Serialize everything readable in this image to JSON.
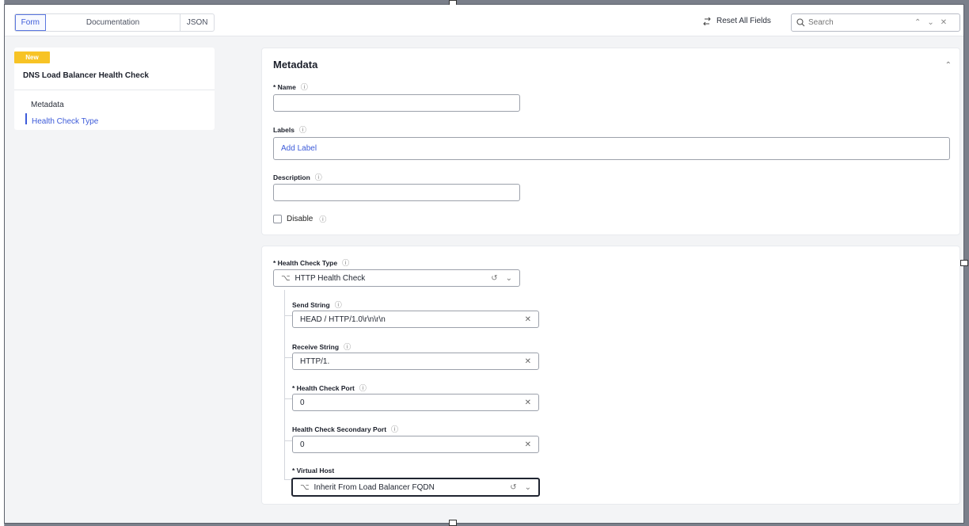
{
  "topbar": {
    "tabs": [
      "Form",
      "Documentation",
      "JSON"
    ],
    "active_tab": "Form",
    "reset_label": "Reset All Fields",
    "search_placeholder": "Search"
  },
  "nav": {
    "badge": "New",
    "title": "DNS Load Balancer Health Check",
    "items": [
      {
        "label": "Metadata"
      },
      {
        "label": "Health Check Type"
      }
    ]
  },
  "metadata": {
    "title": "Metadata",
    "name_label": "* Name",
    "name_value": "",
    "labels_label": "Labels",
    "add_label": "Add Label",
    "description_label": "Description",
    "description_value": "",
    "disable_label": "Disable"
  },
  "health": {
    "type_label": "* Health Check Type",
    "type_value": "HTTP Health Check",
    "send_label": "Send String",
    "send_value": "HEAD / HTTP/1.0\\r\\n\\r\\n",
    "receive_label": "Receive String",
    "receive_value": "HTTP/1.",
    "port_label": "* Health Check Port",
    "port_value": "0",
    "secondary_label": "Health Check Secondary Port",
    "secondary_value": "0",
    "vhost_label": "* Virtual Host",
    "vhost_value": "Inherit From Load Balancer FQDN"
  },
  "colors": {
    "accent": "#3d5bd9",
    "badge": "#f7c325"
  }
}
